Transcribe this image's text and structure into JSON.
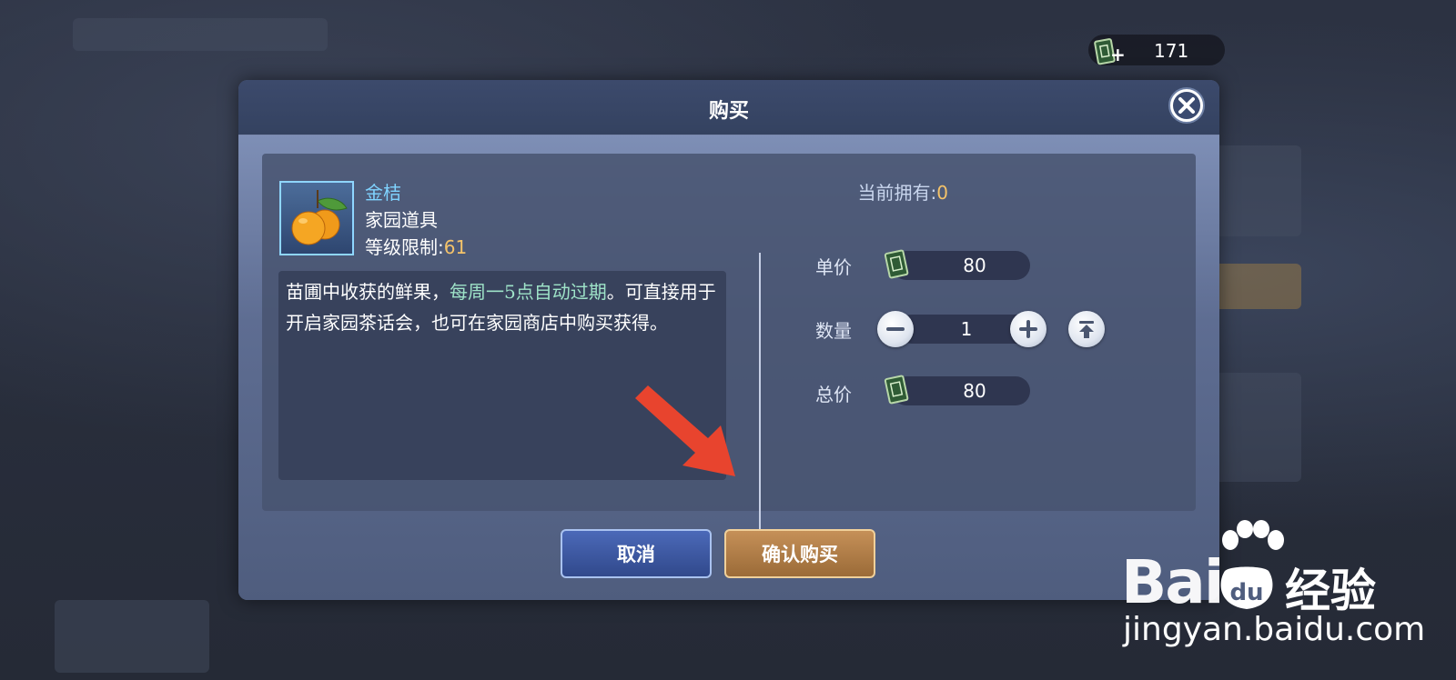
{
  "currency": {
    "amount": "171",
    "icon": "ticket-icon",
    "plus_icon": "plus-icon"
  },
  "dialog": {
    "title": "购买",
    "close_icon": "close-icon"
  },
  "item": {
    "name": "金桔",
    "type": "家园道具",
    "level_label": "等级限制:",
    "level_value": "61",
    "owned_label": "当前拥有:",
    "owned_value": "0",
    "desc_part1": "苗圃中收获的鲜果，",
    "desc_highlight": "每周一5点自动过期",
    "desc_part2": "。可直接用于开启家园茶话会，也可在家园商店中购买获得。",
    "icon": "kumquat-icon"
  },
  "purchase": {
    "unit_price_label": "单价",
    "unit_price": "80",
    "quantity_label": "数量",
    "quantity": "1",
    "total_label": "总价",
    "total": "80",
    "minus_icon": "minus-icon",
    "plus_icon": "plus-icon",
    "max_icon": "max-icon"
  },
  "buttons": {
    "cancel": "取消",
    "confirm": "确认购买"
  },
  "watermark": {
    "brand": "Bai",
    "brand_tail": "经验",
    "url": "jingyan.baidu.com"
  },
  "colors": {
    "accent_blue": "#7fd3ff",
    "value_gold": "#f4c36a",
    "highlight_green": "#9ee3c8",
    "arrow_red": "#e8442e"
  }
}
